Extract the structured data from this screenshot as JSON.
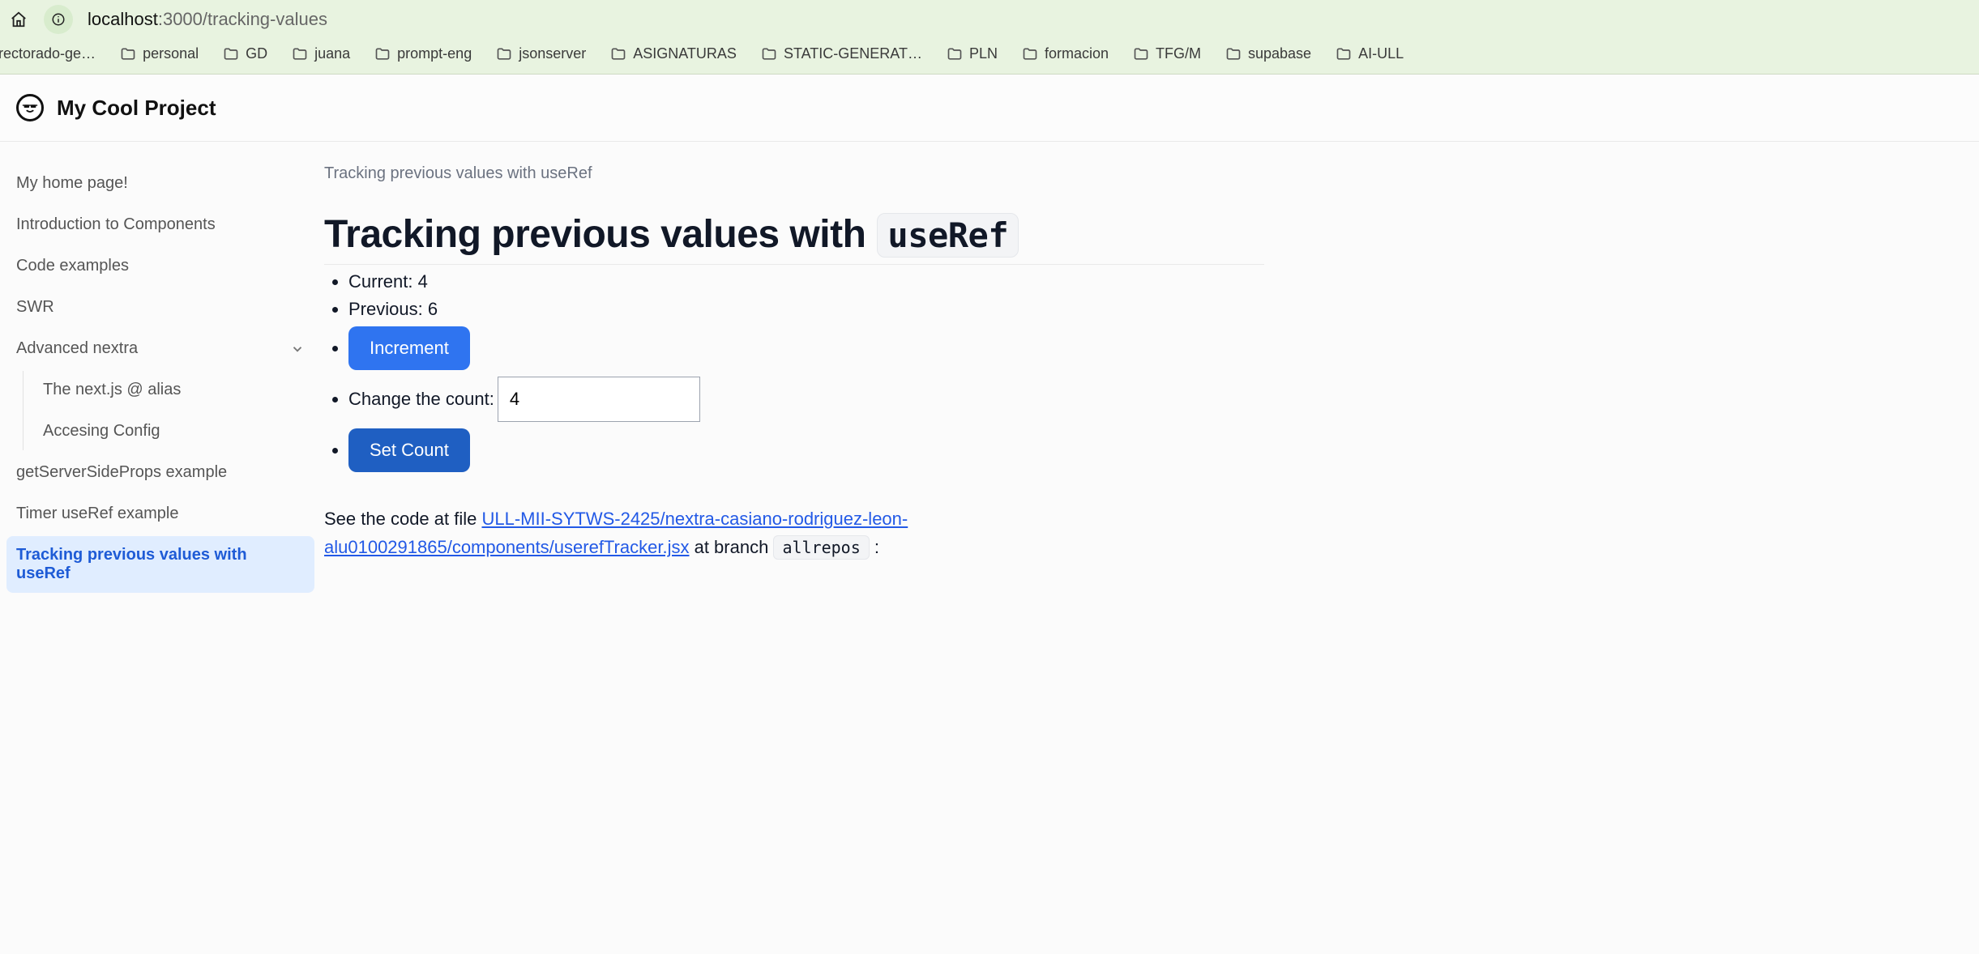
{
  "browser": {
    "url_host": "localhost",
    "url_rest": ":3000/tracking-values",
    "bookmarks": [
      "rectorado-ge…",
      "personal",
      "GD",
      "juana",
      "prompt-eng",
      "jsonserver",
      "ASIGNATURAS",
      "STATIC-GENERAT…",
      "PLN",
      "formacion",
      "TFG/M",
      "supabase",
      "AI-ULL"
    ]
  },
  "header": {
    "project_title": "My Cool Project"
  },
  "sidebar": {
    "items": [
      {
        "label": "My home page!"
      },
      {
        "label": "Introduction to Components"
      },
      {
        "label": "Code examples"
      },
      {
        "label": "SWR"
      },
      {
        "label": "Advanced nextra",
        "expanded": true,
        "children": [
          {
            "label": "The next.js @ alias"
          },
          {
            "label": "Accesing Config"
          }
        ]
      },
      {
        "label": "getServerSideProps example"
      },
      {
        "label": "Timer useRef example"
      },
      {
        "label": "Tracking previous values with useRef",
        "active": true
      }
    ]
  },
  "content": {
    "breadcrumb": "Tracking previous values with useRef",
    "title_prefix": "Tracking previous values with",
    "title_code": "useRef",
    "current_label": "Current:",
    "current_value": "4",
    "previous_label": "Previous:",
    "previous_value": "6",
    "increment_label": "Increment",
    "change_count_label": "Change the count:",
    "count_input_value": "4",
    "set_count_label": "Set Count",
    "see_code_prefix": "See the code at file ",
    "see_code_link": "ULL-MII-SYTWS-2425/nextra-casiano-rodriguez-leon-alu0100291865/components/userefTracker.jsx",
    "see_code_mid": " at branch ",
    "branch_code": "allrepos",
    "see_code_tail": " :"
  }
}
